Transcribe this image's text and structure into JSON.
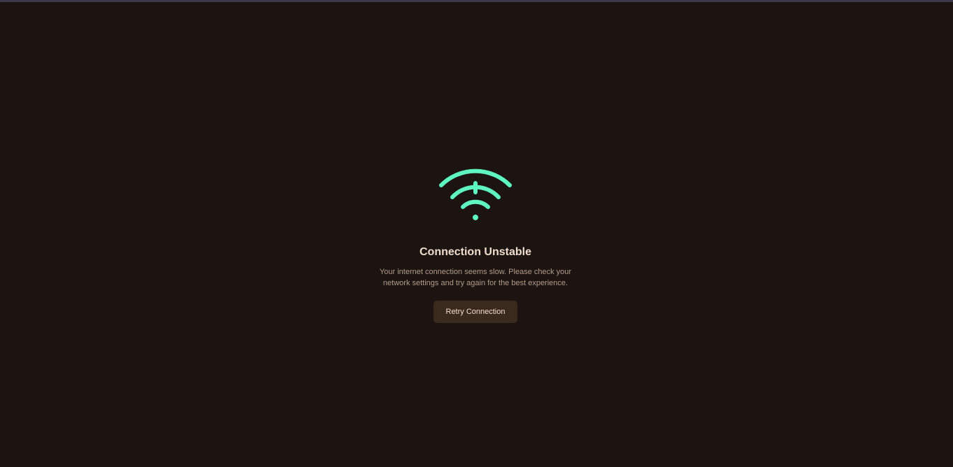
{
  "status": {
    "icon": "wifi-icon",
    "title": "Connection Unstable",
    "message": "Your internet connection seems slow. Please check your network settings and try again for the best experience.",
    "retry_label": "Retry Connection"
  },
  "colors": {
    "background": "#1c1410",
    "icon": "#5ff5c0",
    "title": "#f0dccd",
    "message": "#b39b8b",
    "button_bg": "#3a2a1e",
    "button_text": "#f0dccd"
  }
}
